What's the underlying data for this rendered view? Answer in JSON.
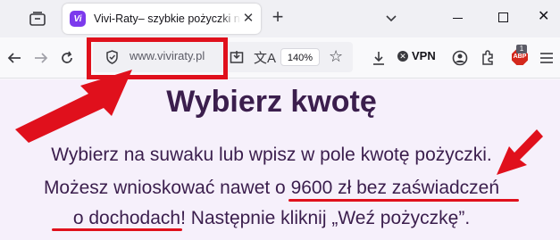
{
  "browser": {
    "tab": {
      "title": "Vivi-Raty– szybkie pożyczki na r",
      "favicon": "Vi"
    },
    "url": "www.viviraty.pl",
    "zoom": "140%",
    "vpn_label": "VPN",
    "abp_badge_count": "1",
    "abp_label": "ABP"
  },
  "page": {
    "heading": "Wybierz kwotę",
    "line1": "Wybierz na suwaku lub wpisz w pole kwotę pożyczki.",
    "line2_a": "Możesz wnioskować nawet o ",
    "line2_b": "9600 zł bez zaświadczeń",
    "line3_a": "o dochodach!",
    "line3_b": " Następnie kliknij „Weź pożyczkę”."
  },
  "colors": {
    "annotation": "#e0101c",
    "page_text": "#3b1e4d",
    "page_bg": "#f6f0fb",
    "brand": "#7c3aed"
  },
  "icons": {
    "tab_strip": [
      "tabs-menu-icon",
      "close-icon",
      "plus-icon",
      "chevron-down-icon",
      "minimize-icon",
      "maximize-icon",
      "window-close-icon"
    ],
    "toolbar": [
      "back-arrow-icon",
      "forward-arrow-icon",
      "reload-icon",
      "shield-icon",
      "page-save-icon",
      "translate-icon",
      "star-icon",
      "download-icon",
      "account-icon",
      "extensions-icon",
      "adblock-icon",
      "menu-icon"
    ]
  }
}
